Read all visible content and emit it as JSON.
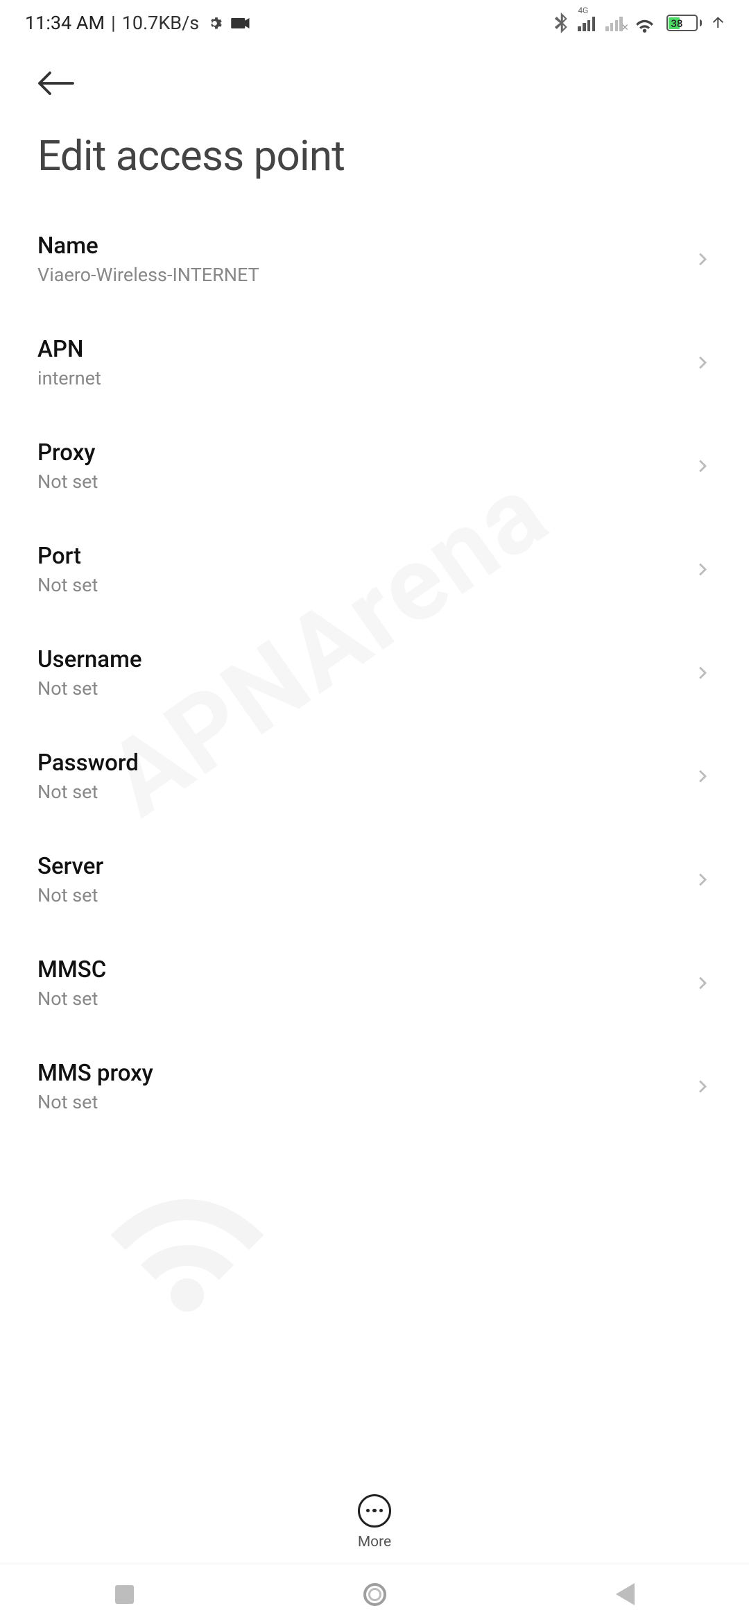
{
  "status": {
    "time": "11:34 AM",
    "separator": "|",
    "net_speed": "10.7KB/s",
    "battery_pct": "38"
  },
  "header": {
    "title": "Edit access point"
  },
  "settings": {
    "name": {
      "label": "Name",
      "value": "Viaero-Wireless-INTERNET"
    },
    "apn": {
      "label": "APN",
      "value": "internet"
    },
    "proxy": {
      "label": "Proxy",
      "value": "Not set"
    },
    "port": {
      "label": "Port",
      "value": "Not set"
    },
    "username": {
      "label": "Username",
      "value": "Not set"
    },
    "password": {
      "label": "Password",
      "value": "Not set"
    },
    "server": {
      "label": "Server",
      "value": "Not set"
    },
    "mmsc": {
      "label": "MMSC",
      "value": "Not set"
    },
    "mms_proxy": {
      "label": "MMS proxy",
      "value": "Not set"
    }
  },
  "footer": {
    "more_label": "More"
  },
  "watermark": "APNArena"
}
